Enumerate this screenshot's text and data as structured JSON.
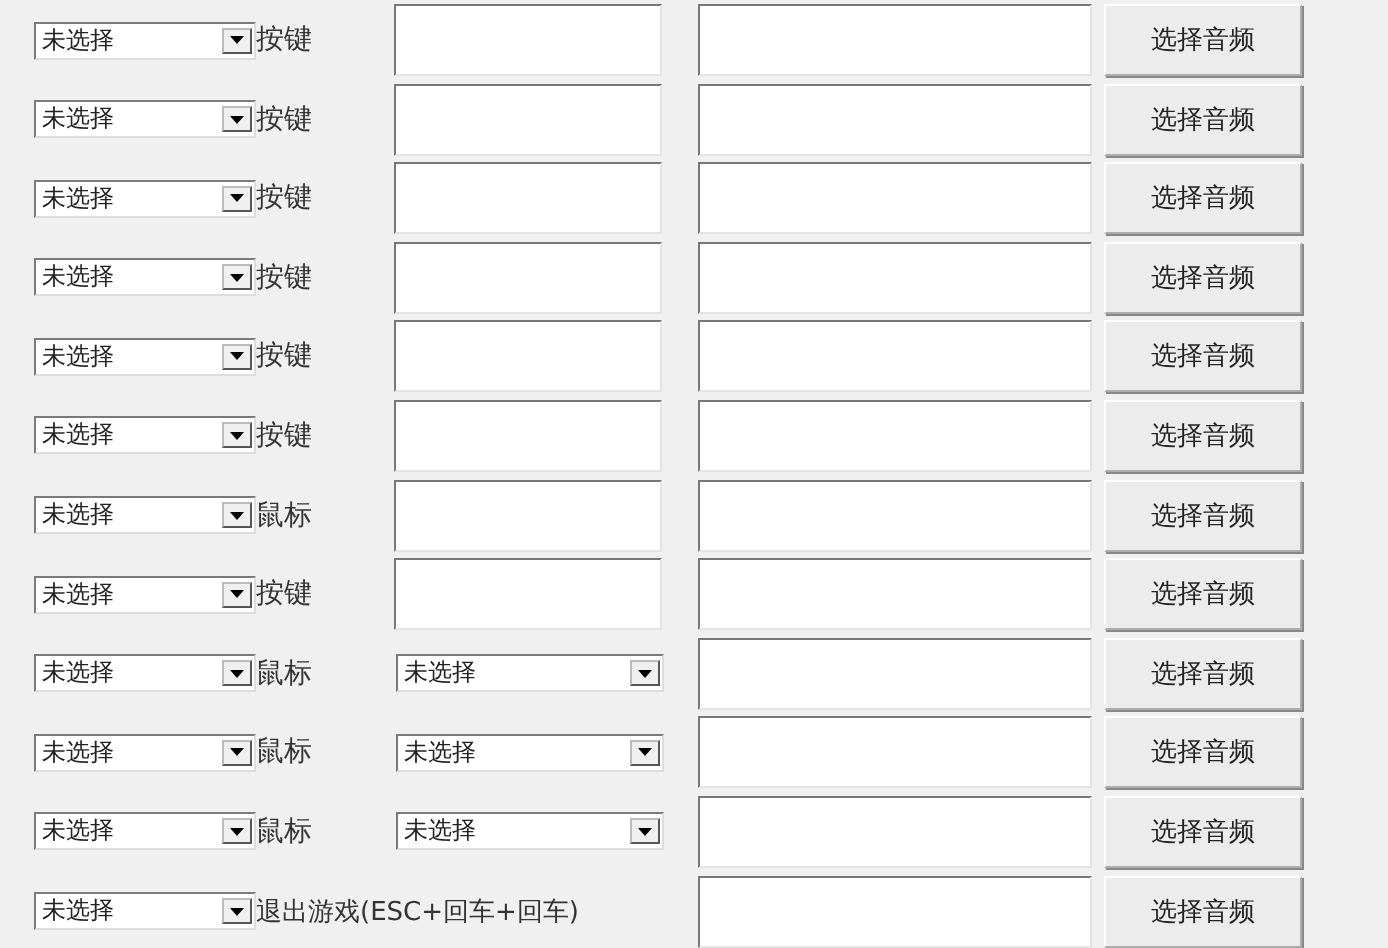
{
  "rows": [
    {
      "select": "未选择",
      "label": "按键",
      "field": {
        "kind": "input"
      },
      "button": "选择音频"
    },
    {
      "select": "未选择",
      "label": "按键",
      "field": {
        "kind": "input"
      },
      "button": "选择音频"
    },
    {
      "select": "未选择",
      "label": "按键",
      "field": {
        "kind": "input"
      },
      "button": "选择音频"
    },
    {
      "select": "未选择",
      "label": "按键",
      "field": {
        "kind": "input"
      },
      "button": "选择音频"
    },
    {
      "select": "未选择",
      "label": "按键",
      "field": {
        "kind": "input"
      },
      "button": "选择音频"
    },
    {
      "select": "未选择",
      "label": "按键",
      "field": {
        "kind": "input"
      },
      "button": "选择音频"
    },
    {
      "select": "未选择",
      "label": "鼠标",
      "field": {
        "kind": "input"
      },
      "button": "选择音频"
    },
    {
      "select": "未选择",
      "label": "按键",
      "field": {
        "kind": "input"
      },
      "button": "选择音频"
    },
    {
      "select": "未选择",
      "label": "鼠标",
      "field": {
        "kind": "select",
        "value": "未选择"
      },
      "button": "选择音频"
    },
    {
      "select": "未选择",
      "label": "鼠标",
      "field": {
        "kind": "select",
        "value": "未选择"
      },
      "button": "选择音频"
    },
    {
      "select": "未选择",
      "label": "鼠标",
      "field": {
        "kind": "select",
        "value": "未选择"
      },
      "button": "选择音频"
    },
    {
      "select": "未选择",
      "label": "退出游戏(ESC+回车+回车)",
      "field": {
        "kind": "none"
      },
      "button": "选择音频"
    }
  ]
}
